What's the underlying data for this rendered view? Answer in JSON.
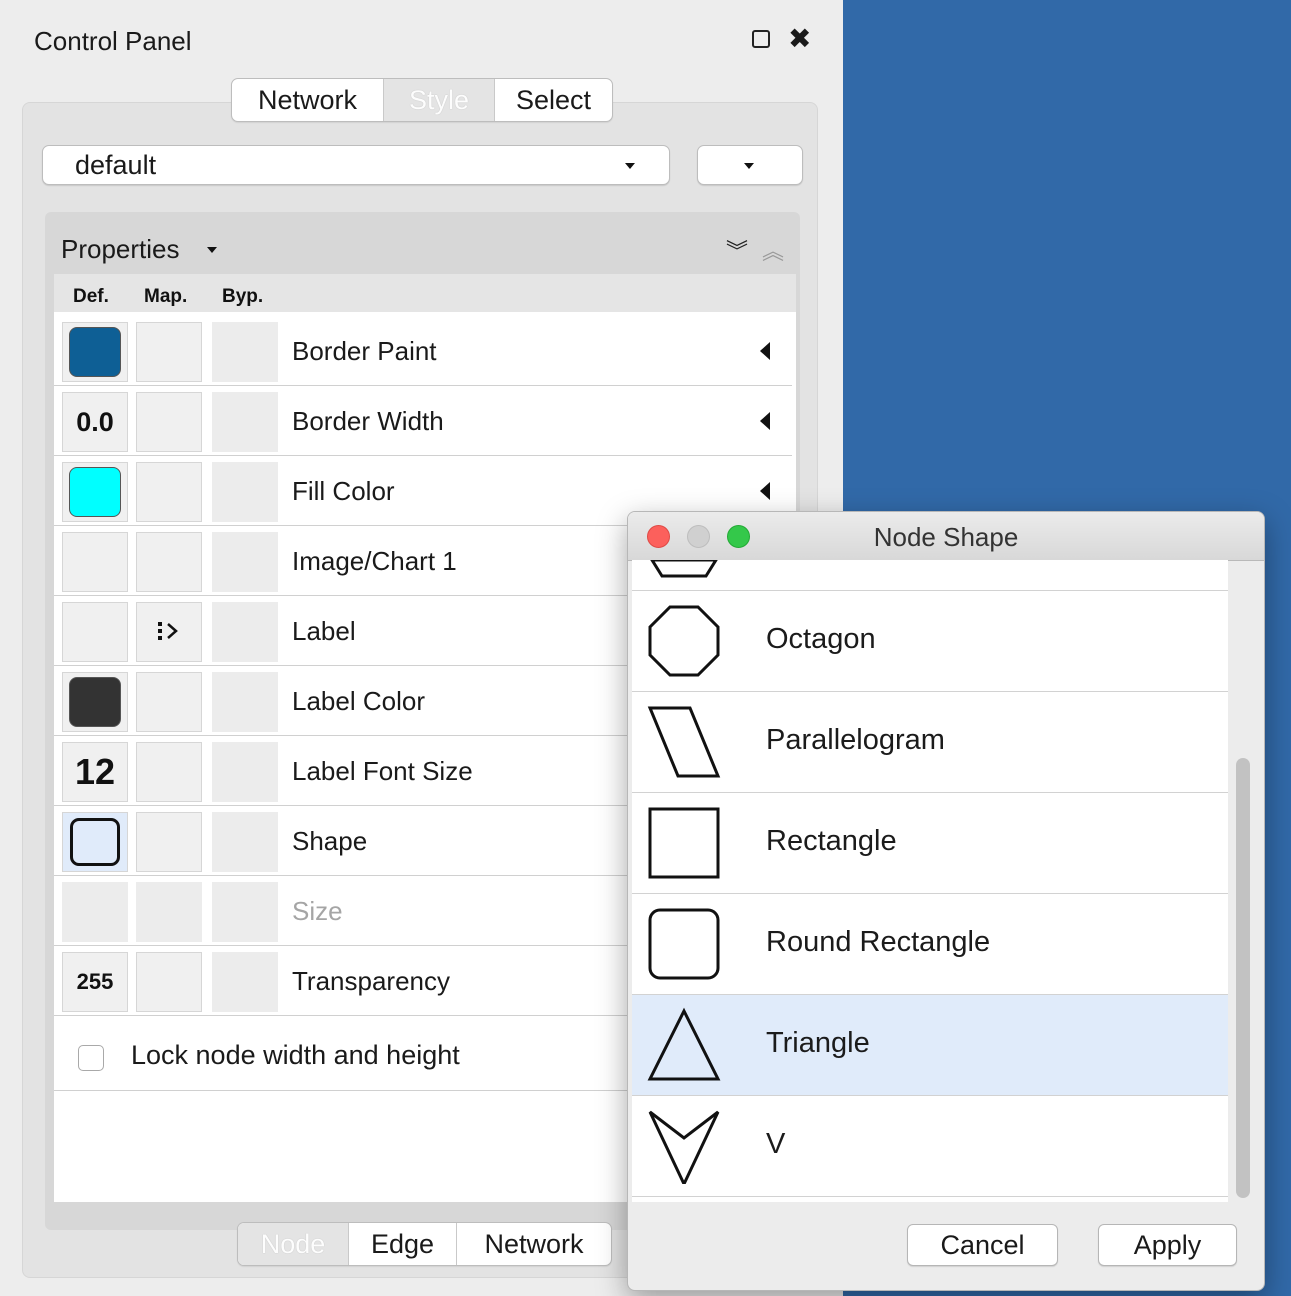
{
  "control_panel": {
    "title": "Control Panel",
    "tabs": [
      "Network",
      "Style",
      "Select"
    ],
    "selected_tab": "Style",
    "style_dropdown": {
      "value": "default"
    },
    "properties": {
      "title": "Properties",
      "columns": [
        "Def.",
        "Map.",
        "Byp."
      ],
      "rows": [
        {
          "label": "Border Paint",
          "default": "",
          "default_color": "#0e5f95"
        },
        {
          "label": "Border Width",
          "default": "0.0"
        },
        {
          "label": "Fill Color",
          "default": "",
          "default_color": "#00ffff"
        },
        {
          "label": "Image/Chart 1",
          "default": ""
        },
        {
          "label": "Label",
          "default": "",
          "mapping_icon": "passthrough-mapping-icon"
        },
        {
          "label": "Label Color",
          "default": "",
          "default_color": "#333333"
        },
        {
          "label": "Label Font Size",
          "default": "12"
        },
        {
          "label": "Shape",
          "default": "",
          "default_shape": "round-rectangle-icon"
        },
        {
          "label": "Size",
          "default": "",
          "disabled": true
        },
        {
          "label": "Transparency",
          "default": "255"
        }
      ],
      "lock_label": "Lock node width and height",
      "lock_checked": false
    },
    "bottom_tabs": [
      "Node",
      "Edge",
      "Network"
    ],
    "selected_bottom_tab": "Node"
  },
  "dialog": {
    "title": "Node Shape",
    "shapes": [
      {
        "label": "",
        "icon": "hexagon-partial-icon"
      },
      {
        "label": "Octagon",
        "icon": "octagon-icon"
      },
      {
        "label": "Parallelogram",
        "icon": "parallelogram-icon"
      },
      {
        "label": "Rectangle",
        "icon": "rectangle-icon"
      },
      {
        "label": "Round Rectangle",
        "icon": "round-rectangle-icon"
      },
      {
        "label": "Triangle",
        "icon": "triangle-icon",
        "selected": true
      },
      {
        "label": "V",
        "icon": "v-icon"
      }
    ],
    "cancel_label": "Cancel",
    "apply_label": "Apply"
  },
  "colors": {
    "canvas": "#3169a8",
    "selection": "#e0ebfa"
  }
}
